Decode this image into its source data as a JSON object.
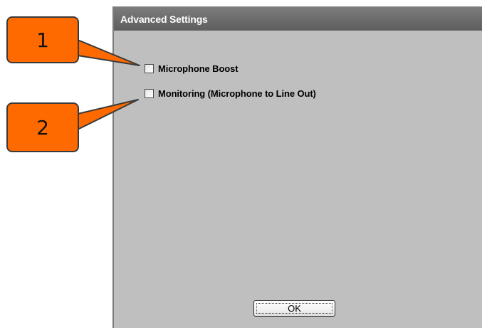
{
  "dialog": {
    "title": "Advanced Settings",
    "checkboxes": [
      {
        "label": "Microphone Boost",
        "checked": false
      },
      {
        "label": "Monitoring (Microphone to Line Out)",
        "checked": false
      }
    ],
    "ok_label": "OK"
  },
  "callouts": [
    {
      "number": "1"
    },
    {
      "number": "2"
    }
  ],
  "colors": {
    "callout_fill": "#ff6a00",
    "dialog_bg": "#bfbfbf",
    "titlebar": "#6b6b6b"
  }
}
